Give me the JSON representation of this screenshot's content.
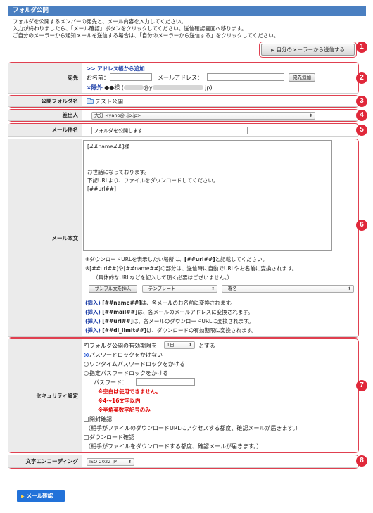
{
  "page": {
    "title": "フォルダ公開",
    "intro": [
      "フォルダを公開するメンバーの宛先と、メール内容を入力してください。",
      "入力が終わりましたら、「メール確認」ボタンをクリックしてください。送信確認画面へ移ります。",
      "ご自分のメーラーから通知メールを送信する場合は、「自分のメーラーから送信する」をクリックしてください。"
    ]
  },
  "send_self": {
    "label": "自分のメーラーから送信する"
  },
  "markers": [
    "1",
    "2",
    "3",
    "4",
    "5",
    "6",
    "7",
    "8"
  ],
  "recipient": {
    "label": "宛先",
    "address_book_link": ">> アドレス帳から追加",
    "name_label": "お名前：",
    "email_label": "メールアドレス：",
    "add_button": "宛先追加",
    "remove_link": "×除外",
    "entry_name": "●●様",
    "entry_paren_open": "(",
    "entry_mid": "@y",
    "entry_paren_close": ".jp)"
  },
  "folder": {
    "label": "公開フォルダ名",
    "name": "テスト公開"
  },
  "sender": {
    "label": "差出人",
    "value": "大分 <yano@              .jp.jp>"
  },
  "subject": {
    "label": "メール件名",
    "value": "フォルダを公開します"
  },
  "body": {
    "label": "メール本文",
    "lines": [
      "[##name##]様",
      "",
      "",
      "お世話になっております。",
      "下記URLより、ファイルをダウンロードしてください。",
      "[##url##]"
    ],
    "note1_pre": "※ダウンロードURLを表示したい場所に、",
    "note1_code": "[##url##]",
    "note1_post": "と記載してください。",
    "note2": "※[##url##]や[##name##]の部分は、送信時に自動でURLやお名前に変換されます。",
    "note3": "（具体的なURLなどを記入して頂く必要はございません。）",
    "sample_button": "サンプル文を挿入",
    "template_select": "--テンプレート--",
    "signature_select": "--署名--",
    "inserts": [
      {
        "tag": "(挿入)",
        "code": "[##name##]",
        "desc": "は、各メールのお名前に変換されます。"
      },
      {
        "tag": "(挿入)",
        "code": "[##mail##]",
        "desc": "は、各メールのメールアドレスに変換されます。"
      },
      {
        "tag": "(挿入)",
        "code": "[##url##]",
        "desc": "は、各メールのダウンロードURLに変換されます。"
      },
      {
        "tag": "(挿入)",
        "code": "[##dl_limit##]",
        "desc": "は、ダウンロードの有効期限に変換されます。"
      }
    ]
  },
  "security": {
    "label": "セキュリティ設定",
    "expiry_pre": "フォルダ公開の有効期限を",
    "expiry_value": "1日",
    "expiry_post": "とする",
    "radio_none": "パスワードロックをかけない",
    "radio_onetime": "ワンタイムパスワードロックをかける",
    "radio_fixed": "指定パスワードロックをかける",
    "password_label": "パスワード：",
    "rule1": "※空白は使用できません。",
    "rule2": "※4～16文字以内",
    "rule3": "※半角英数字記号のみ",
    "open_confirm": "開封確認",
    "open_confirm_desc": "（相手がファイルのダウンロードURLにアクセスする都度、確認メールが届きます。）",
    "dl_confirm": "ダウンロード確認",
    "dl_confirm_desc": "（相手がファイルをダウンロードする都度、確認メールが届きます。）"
  },
  "encoding": {
    "label": "文字エンコーディング",
    "value": "ISO-2022-JP"
  },
  "confirm": {
    "label": "メール確認"
  },
  "colors": {
    "header": "#4a7fc1",
    "marker": "#e0283a",
    "link": "#1d3fa8",
    "warning": "#e00000",
    "button": "#2272d9"
  }
}
